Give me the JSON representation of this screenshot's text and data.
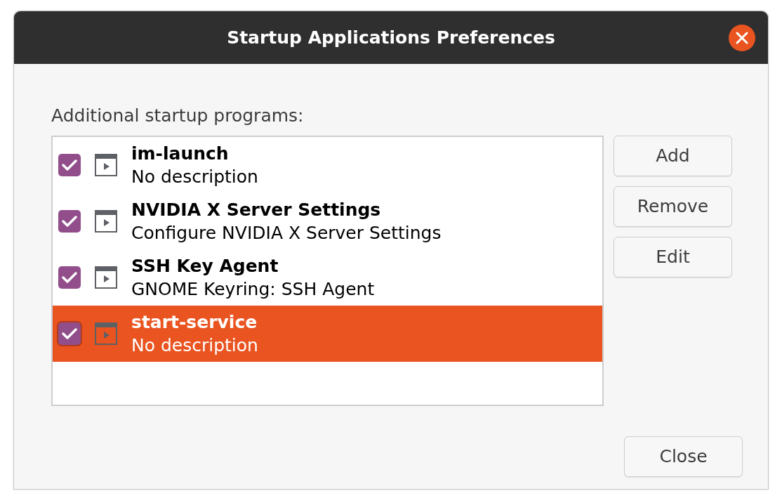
{
  "window": {
    "title": "Startup Applications Preferences"
  },
  "list_label": "Additional startup programs:",
  "items": [
    {
      "name": "im-launch",
      "description": "No description",
      "checked": true,
      "selected": false
    },
    {
      "name": "NVIDIA X Server Settings",
      "description": "Configure NVIDIA X Server Settings",
      "checked": true,
      "selected": false
    },
    {
      "name": "SSH Key Agent",
      "description": "GNOME Keyring: SSH Agent",
      "checked": true,
      "selected": false
    },
    {
      "name": "start-service",
      "description": "No description",
      "checked": true,
      "selected": true
    }
  ],
  "side_buttons": [
    "Add",
    "Remove",
    "Edit"
  ],
  "close_button": "Close"
}
